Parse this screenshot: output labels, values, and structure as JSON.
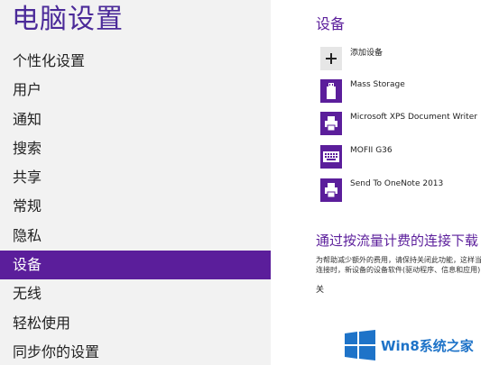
{
  "page_title": "电脑设置",
  "nav_items": [
    {
      "label": "个性化设置",
      "selected": false
    },
    {
      "label": "用户",
      "selected": false
    },
    {
      "label": "通知",
      "selected": false
    },
    {
      "label": "搜索",
      "selected": false
    },
    {
      "label": "共享",
      "selected": false
    },
    {
      "label": "常规",
      "selected": false
    },
    {
      "label": "隐私",
      "selected": false
    },
    {
      "label": "设备",
      "selected": true
    },
    {
      "label": "无线",
      "selected": false
    },
    {
      "label": "轻松使用",
      "selected": false
    },
    {
      "label": "同步你的设置",
      "selected": false
    }
  ],
  "devices": {
    "section_title": "设备",
    "items": [
      {
        "label": "添加设备",
        "icon": "plus-icon"
      },
      {
        "label": "Mass Storage",
        "icon": "usb-drive-icon"
      },
      {
        "label": "Microsoft XPS Document Writer",
        "icon": "printer-icon"
      },
      {
        "label": "MOFII G36",
        "icon": "keyboard-icon"
      },
      {
        "label": "Send To OneNote 2013",
        "icon": "printer-icon"
      }
    ]
  },
  "metered": {
    "heading": "通过按流量计费的连接下载",
    "description_line1": "为帮助减少额外的费用，请保持关闭此功能，这样当",
    "description_line2": "连接时，新设备的设备软件(驱动程序、信息和应用)",
    "toggle_state": "关"
  },
  "watermark": {
    "text": "Win8系统之家",
    "color": "#1e73c8"
  },
  "colors": {
    "accent": "#5b1e9b",
    "title": "#4b2a99",
    "left_background": "#f2f2f2"
  }
}
